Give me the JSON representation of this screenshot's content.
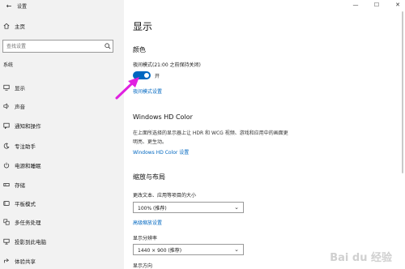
{
  "window": {
    "title": "设置"
  },
  "sidebar": {
    "home": "主页",
    "search_placeholder": "查找设置",
    "section": "系统",
    "items": [
      {
        "icon": "monitor-icon",
        "label": "显示"
      },
      {
        "icon": "speaker-icon",
        "label": "声音"
      },
      {
        "icon": "notification-icon",
        "label": "通知和操作"
      },
      {
        "icon": "moon-icon",
        "label": "专注助手"
      },
      {
        "icon": "power-icon",
        "label": "电源和睡眠"
      },
      {
        "icon": "storage-icon",
        "label": "存储"
      },
      {
        "icon": "tablet-icon",
        "label": "平板模式"
      },
      {
        "icon": "multitask-icon",
        "label": "多任务处理"
      },
      {
        "icon": "project-icon",
        "label": "投影到此电脑"
      },
      {
        "icon": "share-icon",
        "label": "体验共享"
      }
    ]
  },
  "main": {
    "title": "显示",
    "color_heading": "颜色",
    "night_light_label": "夜间模式(21:00 之前保持关闭)",
    "toggle_state": "开",
    "night_light_link": "夜间模式设置",
    "hd_heading": "Windows HD Color",
    "hd_desc_line1": "在上面所选择的显示器上让 HDR 和 WCG 视频、游戏和应用中的画面更",
    "hd_desc_line2": "明亮、更生动。",
    "hd_link": "Windows HD Color 设置",
    "scale_heading": "缩放与布局",
    "scale_label": "更改文本、应用等项目的大小",
    "scale_value": "100% (推荐)",
    "advanced_scale_link": "高级缩放设置",
    "resolution_label": "显示分辨率",
    "resolution_value": "1440 × 900 (推荐)",
    "orientation_label": "显示方向"
  },
  "window_controls": {
    "minimize": "—",
    "maximize": "☐",
    "close": "✕"
  },
  "watermark": "Bai du 经验",
  "colors": {
    "accent": "#0067c0",
    "arrow": "#e020e0",
    "sidebar_bg": "#f2f2f2"
  }
}
